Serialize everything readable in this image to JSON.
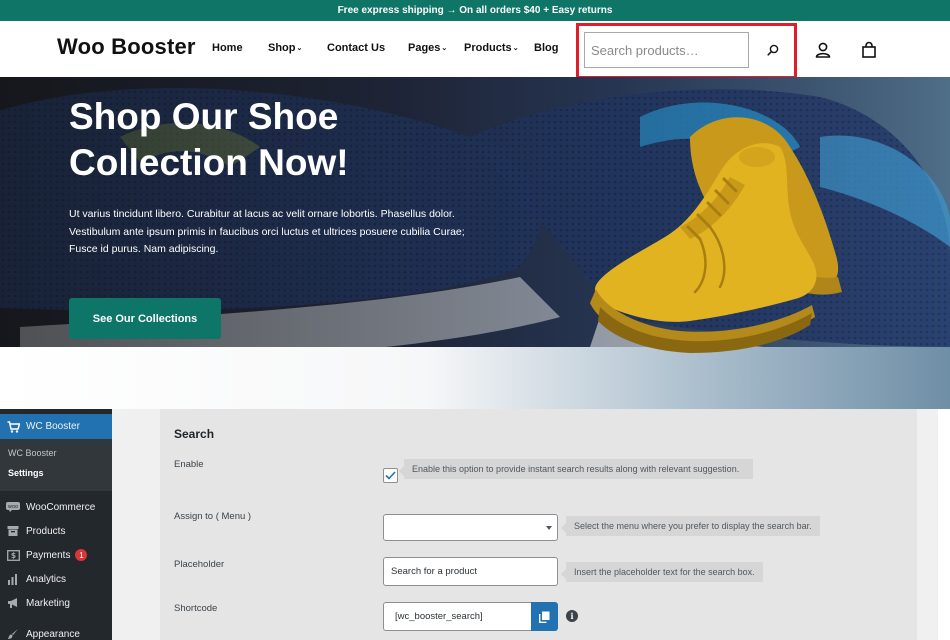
{
  "announcement": "Free express shipping → On all orders $40 + Easy returns",
  "header": {
    "logo": "Woo Booster",
    "nav": [
      {
        "label": "Home",
        "dropdown": false
      },
      {
        "label": "Shop",
        "dropdown": true
      },
      {
        "label": "Contact Us",
        "dropdown": false
      },
      {
        "label": "Pages",
        "dropdown": true
      },
      {
        "label": "Products",
        "dropdown": true
      },
      {
        "label": "Blog",
        "dropdown": false
      }
    ],
    "search": {
      "placeholder": "Search products…",
      "value": ""
    },
    "icons": [
      "search-icon",
      "user-icon",
      "shopping-bag-icon"
    ]
  },
  "hero": {
    "title": "Shop Our Shoe Collection Now!",
    "text": "Ut varius tincidunt libero. Curabitur at lacus ac velit ornare lobortis. Phasellus dolor. Vestibulum ante ipsum primis in faucibus orci luctus et ultrices posuere cubilia Curae; Fusce id purus. Nam adipiscing.",
    "button": "See Our Collections"
  },
  "sidebar": {
    "active": {
      "label": "WC Booster",
      "icon": "cart-icon"
    },
    "submenu": [
      {
        "label": "WC Booster",
        "current": false
      },
      {
        "label": "Settings",
        "current": true
      }
    ],
    "items": [
      {
        "label": "WooCommerce",
        "icon": "woo-icon",
        "badge": ""
      },
      {
        "label": "Products",
        "icon": "archive-icon",
        "badge": ""
      },
      {
        "label": "Payments",
        "icon": "dollar-icon",
        "badge": "1"
      },
      {
        "label": "Analytics",
        "icon": "bar-chart-icon",
        "badge": ""
      },
      {
        "label": "Marketing",
        "icon": "megaphone-icon",
        "badge": ""
      },
      {
        "label": "Appearance",
        "icon": "brush-icon",
        "badge": ""
      }
    ]
  },
  "settings": {
    "title": "Search",
    "enable": {
      "label": "Enable",
      "checked": true,
      "description": "Enable this option to provide instant search results along with relevant suggestion."
    },
    "assign_menu": {
      "label": "Assign to ( Menu )",
      "value": "",
      "description": "Select the menu where you prefer to display the search bar."
    },
    "placeholder": {
      "label": "Placeholder",
      "value": "Search for a product",
      "description": "Insert the placeholder text for the search box."
    },
    "shortcode": {
      "label": "Shortcode",
      "value": "[wc_booster_search]"
    }
  },
  "colors": {
    "brand_teal": "#0f7566",
    "highlight_red": "#e01e2a",
    "wp_sidebar": "#23282d",
    "wp_blue": "#2271b1",
    "shoe_yellow": "#e1b320"
  }
}
